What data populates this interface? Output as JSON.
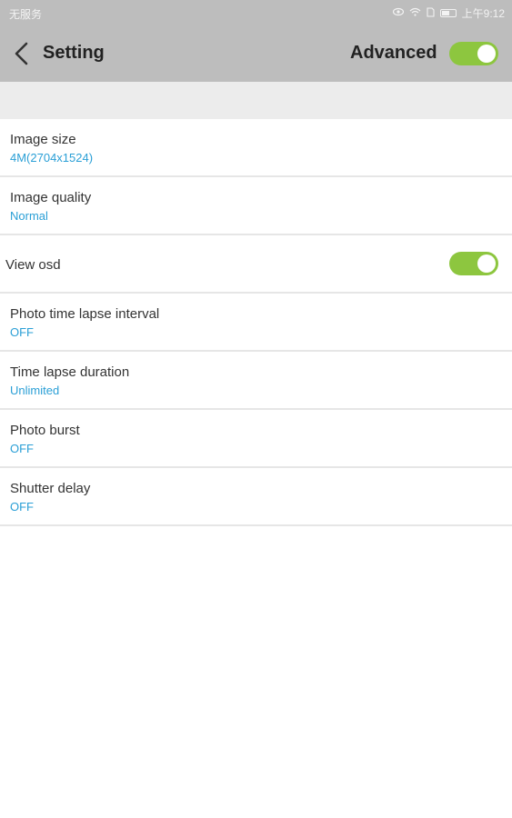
{
  "status_bar": {
    "carrier": "无服务",
    "time": "上午9:12",
    "icons": [
      "eye-icon",
      "wifi-icon",
      "sim-icon",
      "battery-icon"
    ]
  },
  "header": {
    "title": "Setting",
    "advanced_label": "Advanced",
    "advanced_on": true
  },
  "settings": {
    "image_size": {
      "label": "Image size",
      "value": "4M(2704x1524)"
    },
    "image_quality": {
      "label": "Image quality",
      "value": "Normal"
    },
    "view_osd": {
      "label": "View osd",
      "on": true
    },
    "photo_time_lapse_interval": {
      "label": "Photo time lapse interval",
      "value": "OFF"
    },
    "time_lapse_duration": {
      "label": "Time lapse duration",
      "value": "Unlimited"
    },
    "photo_burst": {
      "label": "Photo burst",
      "value": "OFF"
    },
    "shutter_delay": {
      "label": "Shutter delay",
      "value": "OFF"
    }
  },
  "colors": {
    "appbar": "#bdbdbd",
    "toggle_on": "#8dc63f",
    "value_text": "#2a9fd6",
    "section_gap": "#ececec"
  }
}
